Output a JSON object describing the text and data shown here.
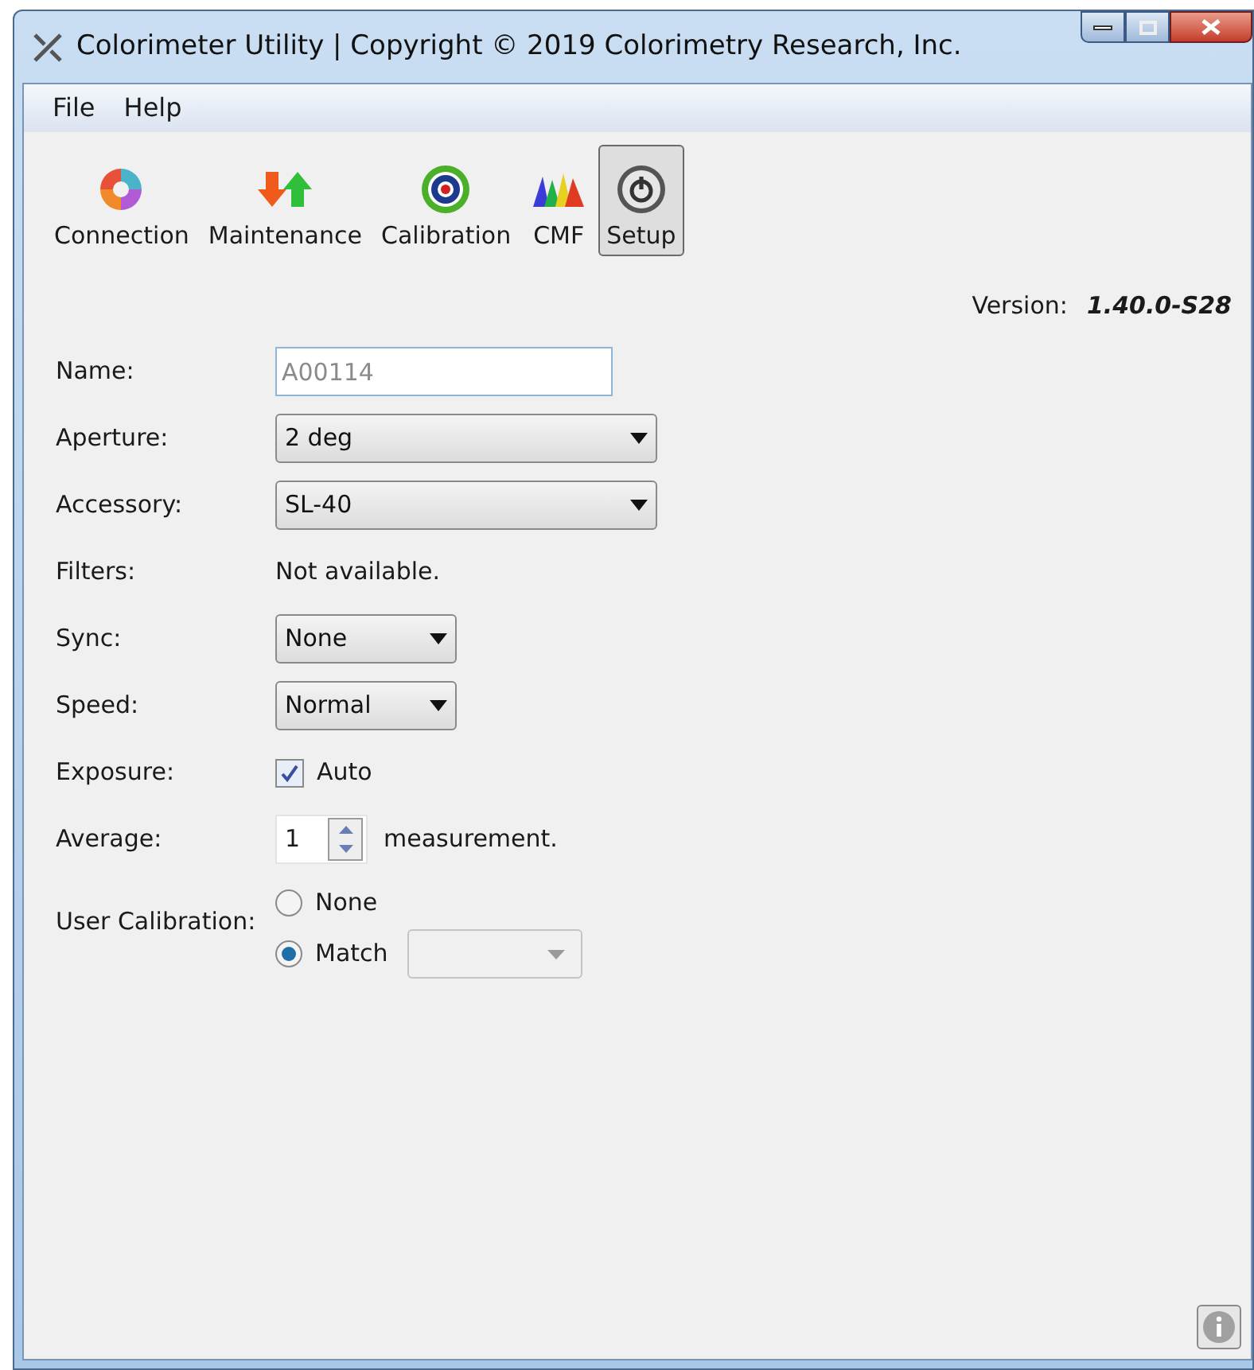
{
  "window": {
    "title": "Colorimeter Utility | Copyright © 2019 Colorimetry Research, Inc."
  },
  "menu": [
    {
      "label": "File"
    },
    {
      "label": "Help"
    }
  ],
  "toolbar": [
    {
      "label": "Connection",
      "kind": "connection",
      "selected": false
    },
    {
      "label": "Maintenance",
      "kind": "maintenance",
      "selected": false
    },
    {
      "label": "Calibration",
      "kind": "calibration",
      "selected": false
    },
    {
      "label": "CMF",
      "kind": "cmf",
      "selected": false
    },
    {
      "label": "Setup",
      "kind": "setup",
      "selected": true
    }
  ],
  "version": {
    "label": "Version:",
    "value": "1.40.0-S28"
  },
  "form": [
    {
      "label": "Name:",
      "kind": "text",
      "placeholder": "A00114"
    },
    {
      "label": "Aperture:",
      "kind": "wide-dropdown",
      "value": "2 deg"
    },
    {
      "label": "Accessory:",
      "kind": "wide-dropdown",
      "value": "SL-40"
    },
    {
      "label": "Filters:",
      "kind": "static",
      "value": "Not available."
    },
    {
      "label": "Sync:",
      "kind": "dropdown",
      "value": "None"
    },
    {
      "label": "Speed:",
      "kind": "dropdown",
      "value": "Normal"
    },
    {
      "label": "Exposure:",
      "kind": "checkbox",
      "text": "Auto",
      "checked": true
    },
    {
      "label": "Average:",
      "kind": "spinner",
      "value": "1",
      "unit": "measurement."
    },
    {
      "label": "User Calibration:",
      "kind": "radio",
      "options": [
        {
          "label": "None",
          "selected": false,
          "combo": false
        },
        {
          "label": "Match",
          "selected": true,
          "combo": true
        }
      ]
    }
  ]
}
